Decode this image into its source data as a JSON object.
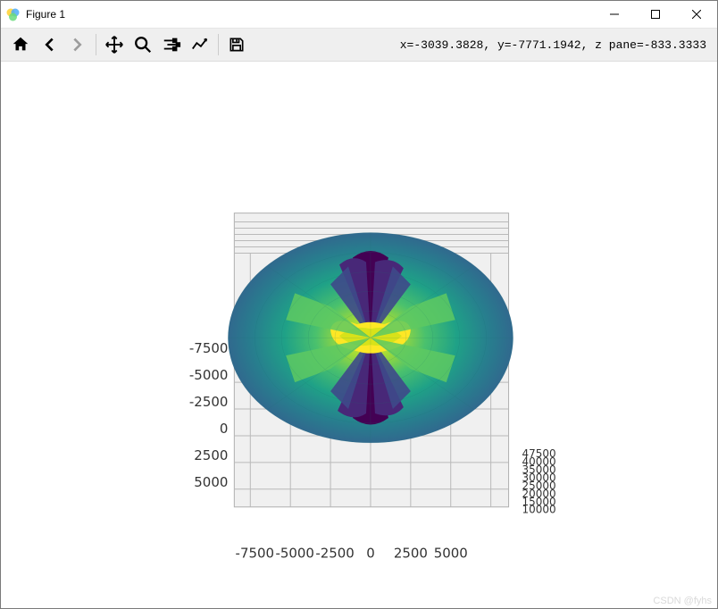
{
  "window": {
    "title": "Figure 1"
  },
  "toolbar": {
    "coords": "x=-3039.3828, y=-7771.1942, z pane=-833.3333"
  },
  "watermark": "CSDN @fyhs",
  "chart_data": {
    "type": "surface_3d",
    "view": "top_down",
    "x_axis": {
      "ticks": [
        -7500,
        -5000,
        -2500,
        0,
        2500,
        5000
      ]
    },
    "y_axis": {
      "ticks": [
        -7500,
        -5000,
        -2500,
        0,
        2500,
        5000
      ]
    },
    "z_axis": {
      "ticks": [
        10000,
        15000,
        20000,
        25000,
        30000,
        35000,
        40000,
        47500
      ]
    },
    "colormap": "viridis",
    "description": "Faceted 3D surface / triangulated sphere colored by value, viewed from above forming an elliptical projection with radial viridis-colored lobes (high yellow in center, dark purple lobes top and bottom, teal-green surrounding)."
  },
  "x_tick_labels": {
    "t0": "-7500",
    "t1": "-5000",
    "t2": "-2500",
    "t3": "0",
    "t4": "2500",
    "t5": "5000"
  },
  "y_tick_labels": {
    "t0": "-7500",
    "t1": "-5000",
    "t2": "-2500",
    "t3": "0",
    "t4": "2500",
    "t5": "5000"
  },
  "z_tick_labels": {
    "t0": "10000",
    "t1": "15000",
    "t2": "20000",
    "t3": "25000",
    "t4": "30000",
    "t5": "35000",
    "t6": "40000",
    "t7": "47500"
  }
}
